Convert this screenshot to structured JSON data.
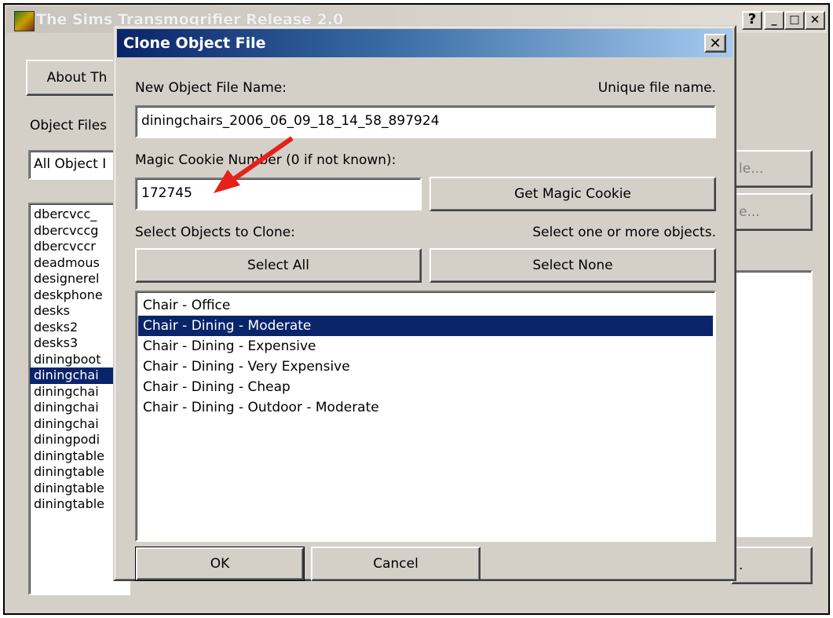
{
  "outer_window": {
    "title": "The Sims Transmogrifier Release 2.0",
    "help_label": "?",
    "minimize_label": "_",
    "maximize_label": "□",
    "close_label": "✕",
    "about_button": "About Th",
    "object_files_label": "Object Files",
    "filter_value": "All Object I",
    "right_button_1_partial": "le...",
    "right_button_2_partial": "e...",
    "bottom_right_button_partial": ".",
    "list_items": [
      {
        "label": "dbercvcc_",
        "selected": false
      },
      {
        "label": "dbercvccg",
        "selected": false
      },
      {
        "label": "dbercvccr",
        "selected": false
      },
      {
        "label": "deadmous",
        "selected": false
      },
      {
        "label": "designerel",
        "selected": false
      },
      {
        "label": "deskphone",
        "selected": false
      },
      {
        "label": "desks",
        "selected": false
      },
      {
        "label": "desks2",
        "selected": false
      },
      {
        "label": "desks3",
        "selected": false
      },
      {
        "label": "diningboot",
        "selected": false
      },
      {
        "label": "diningchai",
        "selected": true
      },
      {
        "label": "diningchai",
        "selected": false
      },
      {
        "label": "diningchai",
        "selected": false
      },
      {
        "label": "diningchai",
        "selected": false
      },
      {
        "label": "diningpodi",
        "selected": false
      },
      {
        "label": "diningtable",
        "selected": false
      },
      {
        "label": "diningtable",
        "selected": false
      },
      {
        "label": "diningtable",
        "selected": false
      },
      {
        "label": "diningtable",
        "selected": false
      }
    ]
  },
  "dialog": {
    "title": "Clone Object File",
    "close_label": "✕",
    "new_file_label": "New Object File Name:",
    "unique_hint": "Unique file name.",
    "file_name_value": "diningchairs_2006_06_09_18_14_58_897924",
    "cookie_label": "Magic Cookie Number (0 if not known):",
    "cookie_value": "172745",
    "get_cookie_button": "Get Magic Cookie",
    "select_label": "Select Objects to Clone:",
    "select_hint": "Select one or more objects.",
    "select_all_button": "Select All",
    "select_none_button": "Select None",
    "objects": [
      {
        "label": "Chair - Office",
        "selected": false
      },
      {
        "label": "Chair - Dining - Moderate",
        "selected": true
      },
      {
        "label": "Chair - Dining - Expensive",
        "selected": false
      },
      {
        "label": "Chair - Dining - Very Expensive",
        "selected": false
      },
      {
        "label": "Chair - Dining - Cheap",
        "selected": false
      },
      {
        "label": "Chair - Dining - Outdoor - Moderate",
        "selected": false
      }
    ],
    "ok_button": "OK",
    "cancel_button": "Cancel"
  },
  "annotation": {
    "arrow_color": "#e8201a"
  }
}
